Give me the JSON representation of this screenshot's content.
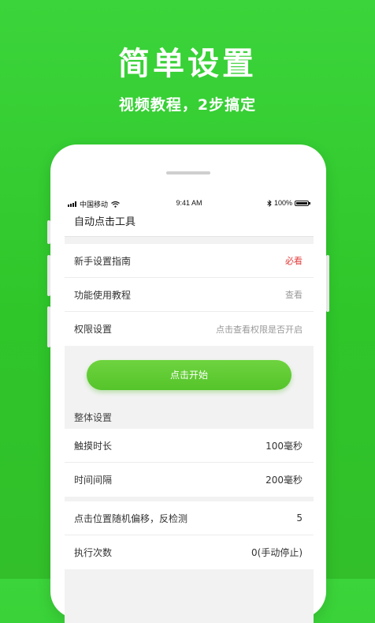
{
  "hero": {
    "title": "简单设置",
    "subtitle": "视频教程，2步搞定"
  },
  "status_bar": {
    "carrier": "中国移动",
    "time": "9:41 AM",
    "battery": "100%"
  },
  "app": {
    "title": "自动点击工具"
  },
  "guide_rows": [
    {
      "label": "新手设置指南",
      "value": "必看"
    },
    {
      "label": "功能使用教程",
      "value": "查看"
    },
    {
      "label": "权限设置",
      "value": "点击查看权限是否开启"
    }
  ],
  "start_button": "点击开始",
  "settings_section": "整体设置",
  "settings_rows_a": [
    {
      "label": "触摸时长",
      "value": "100毫秒"
    },
    {
      "label": "时间间隔",
      "value": "200毫秒"
    }
  ],
  "settings_rows_b": [
    {
      "label": "点击位置随机偏移，反检测",
      "value": "5"
    },
    {
      "label": "执行次数",
      "value": "0(手动停止)"
    }
  ],
  "colors": {
    "background": "#3bd43a",
    "button": "#5ec92f",
    "must_text": "#e33b3b"
  }
}
